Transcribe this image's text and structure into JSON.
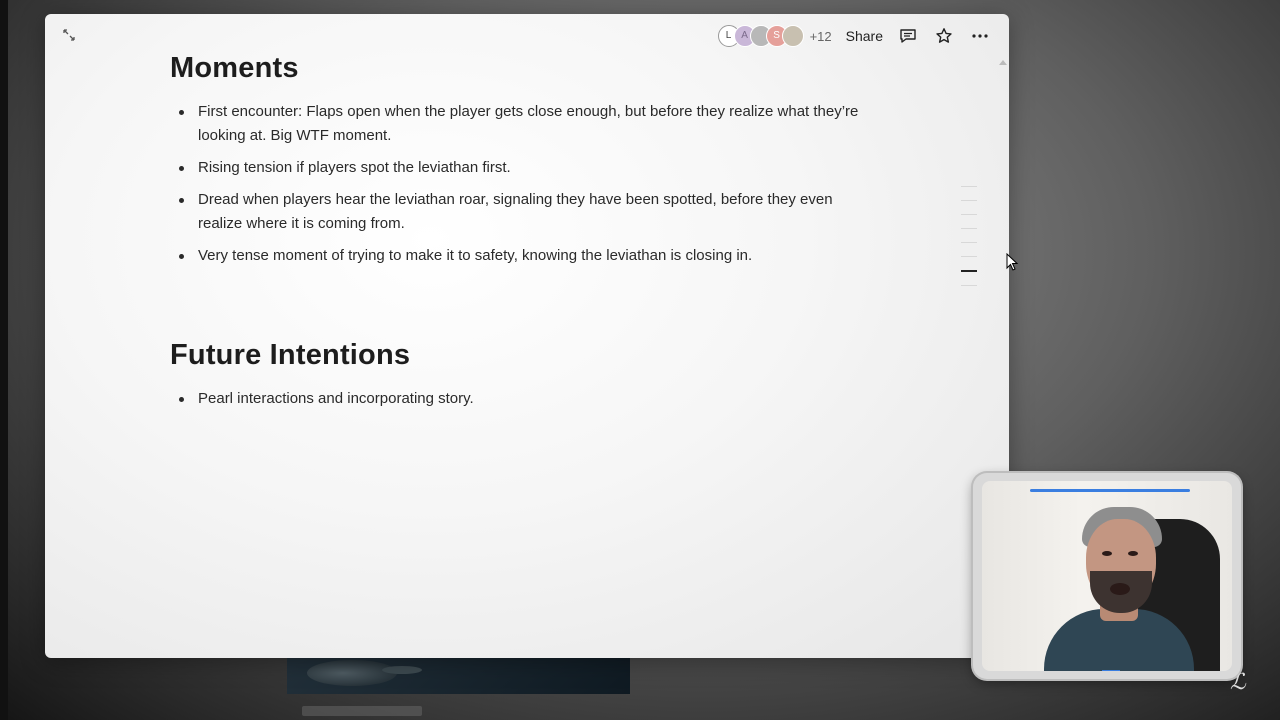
{
  "header": {
    "avatars": [
      "L",
      "A",
      "",
      "S",
      ""
    ],
    "more_count": "+12",
    "share_label": "Share"
  },
  "sections": {
    "moments": {
      "title": "Moments",
      "items": [
        "First encounter: Flaps open when the player gets close enough, but before they realize what they’re looking at. Big WTF moment.",
        "Rising tension if players spot the leviathan first.",
        "Dread when players hear the leviathan roar, signaling they have been spotted, before they even realize where it is coming from.",
        "Very tense moment of trying to make it to safety, knowing the leviathan is closing in."
      ]
    },
    "future": {
      "title": "Future Intentions",
      "items": [
        "Pearl interactions and incorporating story."
      ]
    }
  },
  "icons": {
    "expand": "expand-icon",
    "comment": "comment-icon",
    "star": "star-icon",
    "more": "more-options-icon"
  },
  "colors": {
    "accent": "#3a7ee0",
    "text": "#2a2a2a"
  }
}
